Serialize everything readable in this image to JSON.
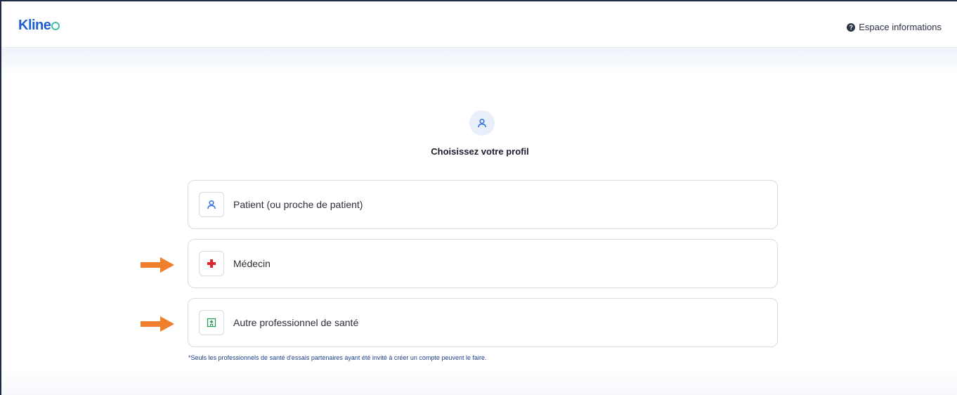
{
  "header": {
    "logo_text": "Kline",
    "info_link_label": "Espace informations",
    "info_icon": "question-circle-icon"
  },
  "main": {
    "title": "Choisissez votre profil",
    "badge_icon": "user-icon",
    "options": [
      {
        "label": "Patient (ou proche de patient)",
        "icon": "user-icon",
        "icon_color": "#2f6fe0"
      },
      {
        "label": "Médecin",
        "icon": "medical-cross-icon",
        "icon_color": "#e0262b"
      },
      {
        "label": "Autre professionnel de santé",
        "icon": "hospital-icon",
        "icon_color": "#2f9e5b"
      }
    ],
    "note": "*Seuls les professionnels de santé d'essais partenaires ayant été invité à créer un compte peuvent le faire."
  },
  "annotations": {
    "arrow_color": "#f07f2d"
  },
  "colors": {
    "brand_blue": "#1f5fd1",
    "brand_green": "#3cc0a8"
  }
}
